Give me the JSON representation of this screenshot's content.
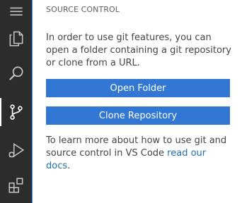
{
  "activity_bar": {
    "items": [
      {
        "icon": "menu-icon",
        "active": false
      },
      {
        "icon": "explorer-files-icon",
        "active": false
      },
      {
        "icon": "search-icon",
        "active": false
      },
      {
        "icon": "source-control-icon",
        "active": true
      },
      {
        "icon": "run-debug-icon",
        "active": false
      },
      {
        "icon": "extensions-icon",
        "active": false
      }
    ],
    "background_color": "#2c2c2c",
    "icon_color": "#c5c5c5",
    "active_icon_color": "#ffffff"
  },
  "sidebar": {
    "title": "SOURCE CONTROL",
    "info_text": "In order to use git features, you can open a folder containing a git repository or clone from a URL.",
    "open_folder_label": "Open Folder",
    "clone_repository_label": "Clone Repository",
    "learn_more_prefix": "To learn more about how to use git and source control in VS Code ",
    "docs_link_text": "read our docs",
    "learn_more_suffix": ".",
    "accent_color": "#3277d4",
    "link_color": "#1f6fb8"
  }
}
